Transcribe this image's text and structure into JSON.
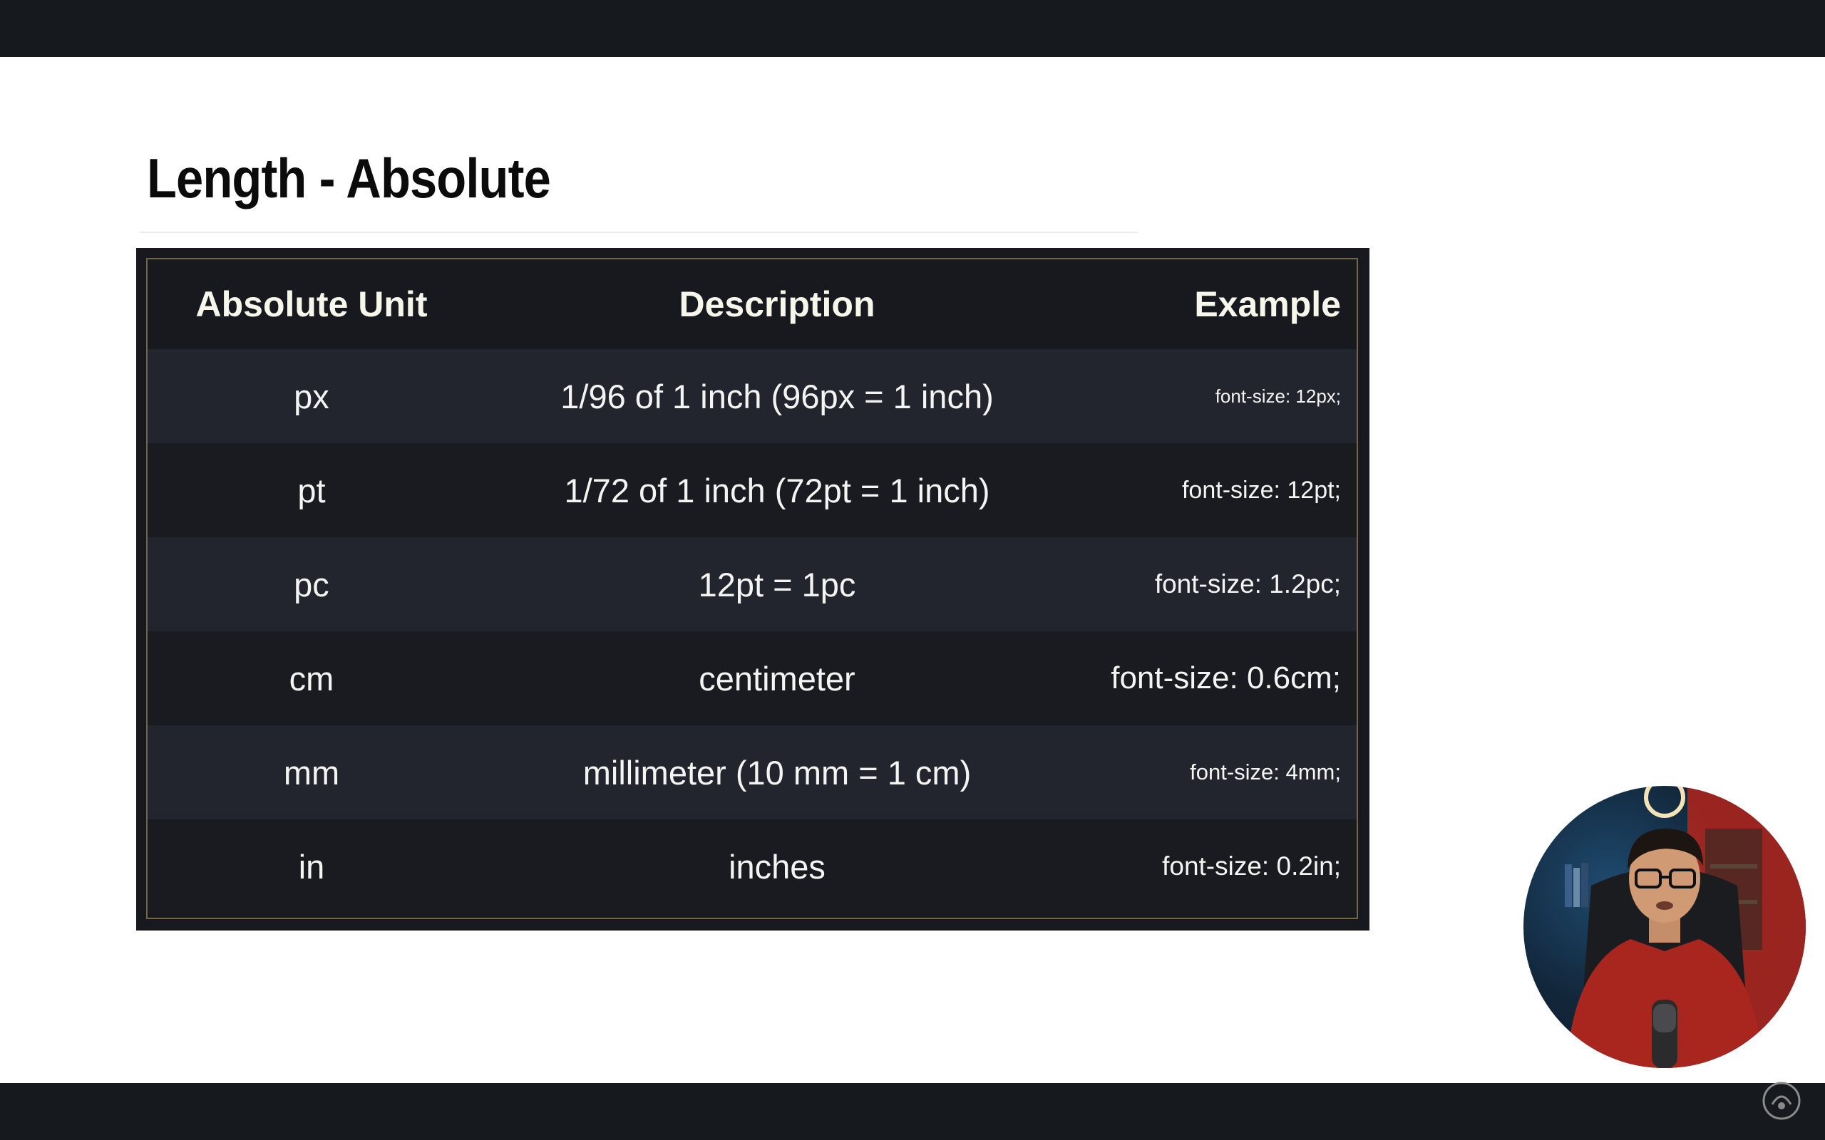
{
  "slide": {
    "title": "Length - Absolute"
  },
  "table": {
    "headers": {
      "unit": "Absolute Unit",
      "description": "Description",
      "example": "Example"
    },
    "rows": [
      {
        "unit": "px",
        "description": "1/96 of 1 inch (96px = 1 inch)",
        "example": "font-size: 12px;"
      },
      {
        "unit": "pt",
        "description": "1/72 of 1 inch (72pt = 1 inch)",
        "example": "font-size: 12pt;"
      },
      {
        "unit": "pc",
        "description": "12pt = 1pc",
        "example": "font-size: 1.2pc;"
      },
      {
        "unit": "cm",
        "description": "centimeter",
        "example": "font-size: 0.6cm;"
      },
      {
        "unit": "mm",
        "description": "millimeter (10 mm = 1 cm)",
        "example": "font-size: 4mm;"
      },
      {
        "unit": "in",
        "description": "inches",
        "example": "font-size: 0.2in;"
      }
    ]
  },
  "colors": {
    "page_background": "#ffffff",
    "letterbox_bars": "#161a1e",
    "table_background": "#17191e",
    "row_alternate": "#22252d",
    "table_border": "#6f6748",
    "text_light": "#f4f4f2",
    "presenter_shirt": "#a8261e"
  },
  "icons": {
    "presenter_webcam": "presenter-webcam-overlay",
    "corner_logo": "channel-logo-icon"
  }
}
